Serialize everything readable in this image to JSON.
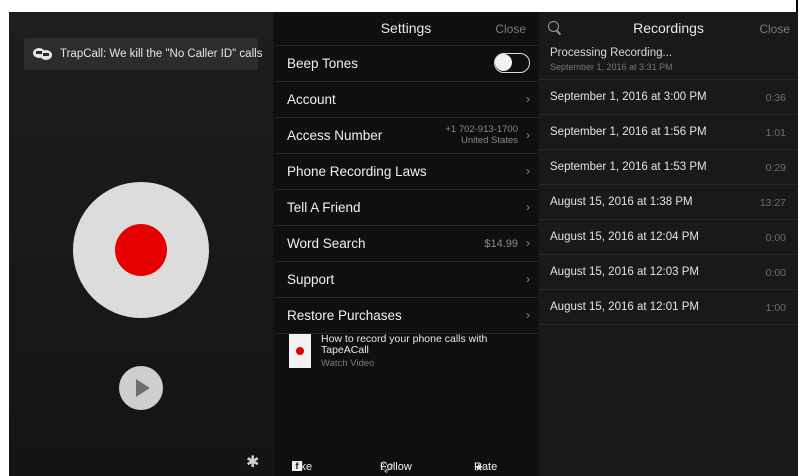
{
  "banner": {
    "text": "TrapCall: We kill the \"No Caller ID\" calls",
    "icon": "trapcall-logo-icon"
  },
  "settings": {
    "title": "Settings",
    "close_label": "Close",
    "rows": [
      {
        "label": "Beep Tones",
        "toggle_on": false
      },
      {
        "label": "Account"
      },
      {
        "label": "Access Number",
        "value_line1": "+1 702-913-1700",
        "value_line2": "United States"
      },
      {
        "label": "Phone Recording Laws"
      },
      {
        "label": "Tell A Friend"
      },
      {
        "label": "Word Search",
        "value": "$14.99"
      },
      {
        "label": "Support"
      },
      {
        "label": "Restore Purchases"
      }
    ],
    "video": {
      "title": "How to record your phone calls with TapeACall",
      "subtitle": "Watch Video"
    },
    "social": {
      "like": "Like",
      "follow": "Follow",
      "rate": "Rate"
    }
  },
  "recordings": {
    "title": "Recordings",
    "close_label": "Close",
    "processing": {
      "title": "Processing Recording...",
      "date": "September 1, 2016 at 3:31 PM"
    },
    "items": [
      {
        "date": "September 1, 2016 at 3:00 PM",
        "duration": "0:36"
      },
      {
        "date": "September 1, 2016 at 1:56 PM",
        "duration": "1:01"
      },
      {
        "date": "September 1, 2016 at 1:53 PM",
        "duration": "0:29"
      },
      {
        "date": "August 15, 2016 at 1:38 PM",
        "duration": "13:27"
      },
      {
        "date": "August 15, 2016 at 12:04 PM",
        "duration": "0:00"
      },
      {
        "date": "August 15, 2016 at 12:03 PM",
        "duration": "0:00"
      },
      {
        "date": "August 15, 2016 at 12:01 PM",
        "duration": "1:00"
      }
    ]
  },
  "colors": {
    "record_red": "#e60000",
    "background": "#161616"
  }
}
